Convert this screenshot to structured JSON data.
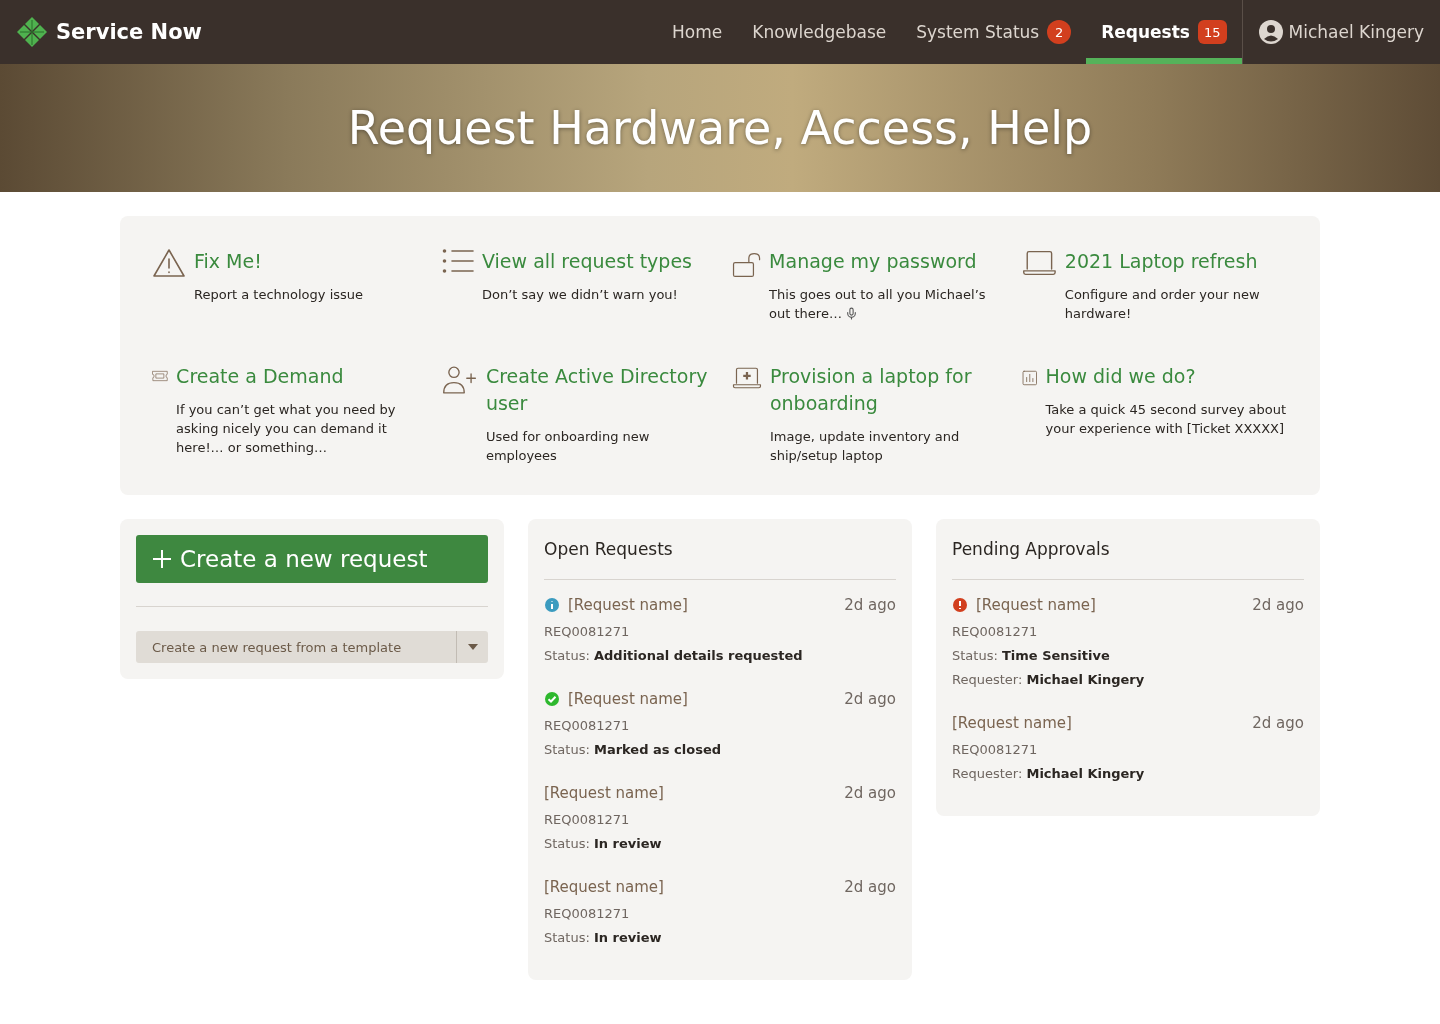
{
  "nav": {
    "brand": "Service Now",
    "items": [
      {
        "label": "Home",
        "selected": false
      },
      {
        "label": "Knowledgebase",
        "selected": false
      },
      {
        "label": "System Status",
        "selected": false,
        "badge": "2"
      },
      {
        "label": "Requests",
        "selected": true,
        "badge": "15"
      }
    ],
    "user": "Michael Kingery"
  },
  "hero": {
    "title": "Request Hardware, Access, Help"
  },
  "quick_links": [
    {
      "kind": "warning",
      "title": "Fix Me!",
      "description": "Report a technology issue"
    },
    {
      "kind": "list",
      "title": "View all request types",
      "description": "Don’t say we didn’t warn you!"
    },
    {
      "kind": "unlock",
      "title": "Manage my password",
      "description": "This goes out to all you Michael’s out there…",
      "has_microphone": true
    },
    {
      "kind": "laptop",
      "title": "2021 Laptop refresh",
      "description": "Configure and order your new hardware!"
    },
    {
      "kind": "ticket",
      "title": "Create a Demand",
      "description": "If you can’t get what you need by asking nicely you can demand it here!… or something…"
    },
    {
      "kind": "user-plus",
      "title": "Create Active Directory user",
      "description": "Used for onboarding new employees"
    },
    {
      "kind": "laptop-plus",
      "title": "Provision a laptop for onboarding",
      "description": "Image, update inventory and ship/setup laptop"
    },
    {
      "kind": "chart",
      "title": "How did we do?",
      "description": "Take a quick 45 second survey about your experience with [Ticket XXXXX]"
    }
  ],
  "create": {
    "button": "Create a new request",
    "template_select": "Create a new request from a template"
  },
  "open_requests": {
    "title": "Open Requests",
    "items": [
      {
        "kind": "info",
        "name": "[Request name]",
        "time": "2d ago",
        "number": "REQ0081271",
        "fields": [
          {
            "label": "Status:",
            "value": "Additional details requested"
          }
        ]
      },
      {
        "kind": "done",
        "name": "[Request name]",
        "time": "2d ago",
        "number": "REQ0081271",
        "fields": [
          {
            "label": "Status:",
            "value": "Marked as closed"
          }
        ]
      },
      {
        "kind": "plain",
        "name": "[Request name]",
        "time": "2d ago",
        "number": "REQ0081271",
        "fields": [
          {
            "label": "Status:",
            "value": "In review"
          }
        ]
      },
      {
        "kind": "plain",
        "name": "[Request name]",
        "time": "2d ago",
        "number": "REQ0081271",
        "fields": [
          {
            "label": "Status:",
            "value": "In review"
          }
        ]
      }
    ]
  },
  "pending_approvals": {
    "title": "Pending Approvals",
    "items": [
      {
        "kind": "alert",
        "name": "[Request name]",
        "time": "2d ago",
        "number": "REQ0081271",
        "fields": [
          {
            "label": "Status:",
            "value": "Time Sensitive"
          },
          {
            "label": "Requester:",
            "value": "Michael Kingery"
          }
        ]
      },
      {
        "kind": "plain",
        "name": "[Request name]",
        "time": "2d ago",
        "number": "REQ0081271",
        "fields": [
          {
            "label": "Requester:",
            "value": "Michael Kingery"
          }
        ]
      }
    ]
  }
}
